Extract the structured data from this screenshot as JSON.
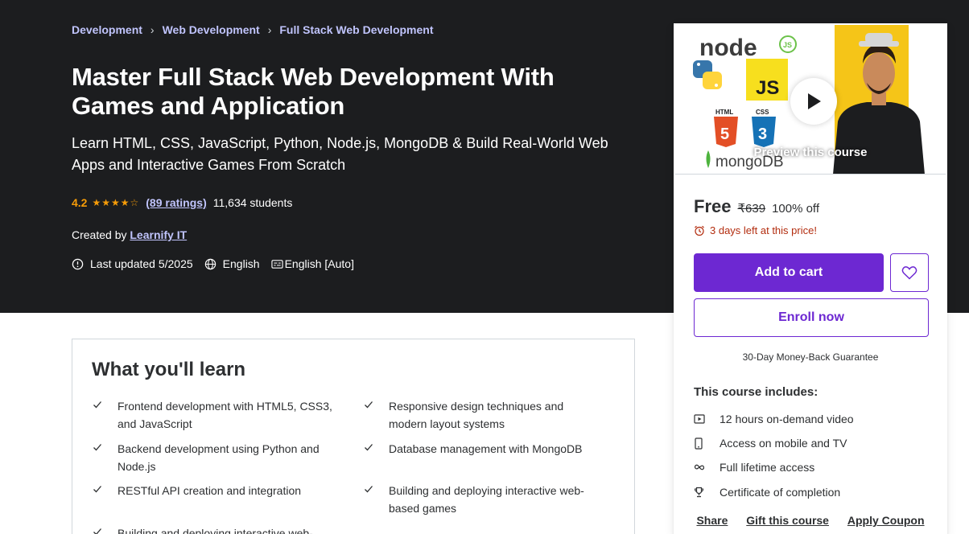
{
  "breadcrumb": [
    "Development",
    "Web Development",
    "Full Stack Web Development"
  ],
  "course": {
    "title": "Master Full Stack Web Development With Games and Application",
    "subtitle": "Learn HTML, CSS, JavaScript, Python, Node.js, MongoDB & Build Real-World Web Apps and Interactive Games From Scratch",
    "rating": "4.2",
    "ratings_count": "(89 ratings)",
    "students": "11,634 students",
    "created_by_label": "Created by",
    "instructor": "Learnify IT",
    "last_updated": "Last updated 5/2025",
    "language": "English",
    "captions": "English [Auto]"
  },
  "learn": {
    "title": "What you'll learn",
    "items": [
      "Frontend development with HTML5, CSS3, and JavaScript",
      "Responsive design techniques and modern layout systems",
      "Backend development using Python and Node.js",
      "Database management with MongoDB",
      "RESTful API creation and integration",
      "Building and deploying interactive web-based games",
      "Building and deploying interactive web-based"
    ]
  },
  "card": {
    "preview_label": "Preview this course",
    "preview_logos": [
      "node",
      "JS",
      "HTML",
      "CSS",
      "mongoDB"
    ],
    "price": "Free",
    "original_price": "₹639",
    "discount": "100% off",
    "countdown": "3 days left at this price!",
    "add_to_cart": "Add to cart",
    "enroll": "Enroll now",
    "guarantee": "30-Day Money-Back Guarantee",
    "includes_title": "This course includes:",
    "includes": [
      {
        "icon": "video-icon",
        "label": "12 hours on-demand video"
      },
      {
        "icon": "mobile-icon",
        "label": "Access on mobile and TV"
      },
      {
        "icon": "infinity-icon",
        "label": "Full lifetime access"
      },
      {
        "icon": "trophy-icon",
        "label": "Certificate of completion"
      }
    ],
    "links": {
      "share": "Share",
      "gift": "Gift this course",
      "coupon": "Apply Coupon"
    }
  },
  "colors": {
    "hero_bg": "#1c1d1f",
    "accent": "#6d28d2",
    "link_light": "#c0c4fc",
    "star": "#f69c08",
    "alert": "#b32d0f"
  }
}
